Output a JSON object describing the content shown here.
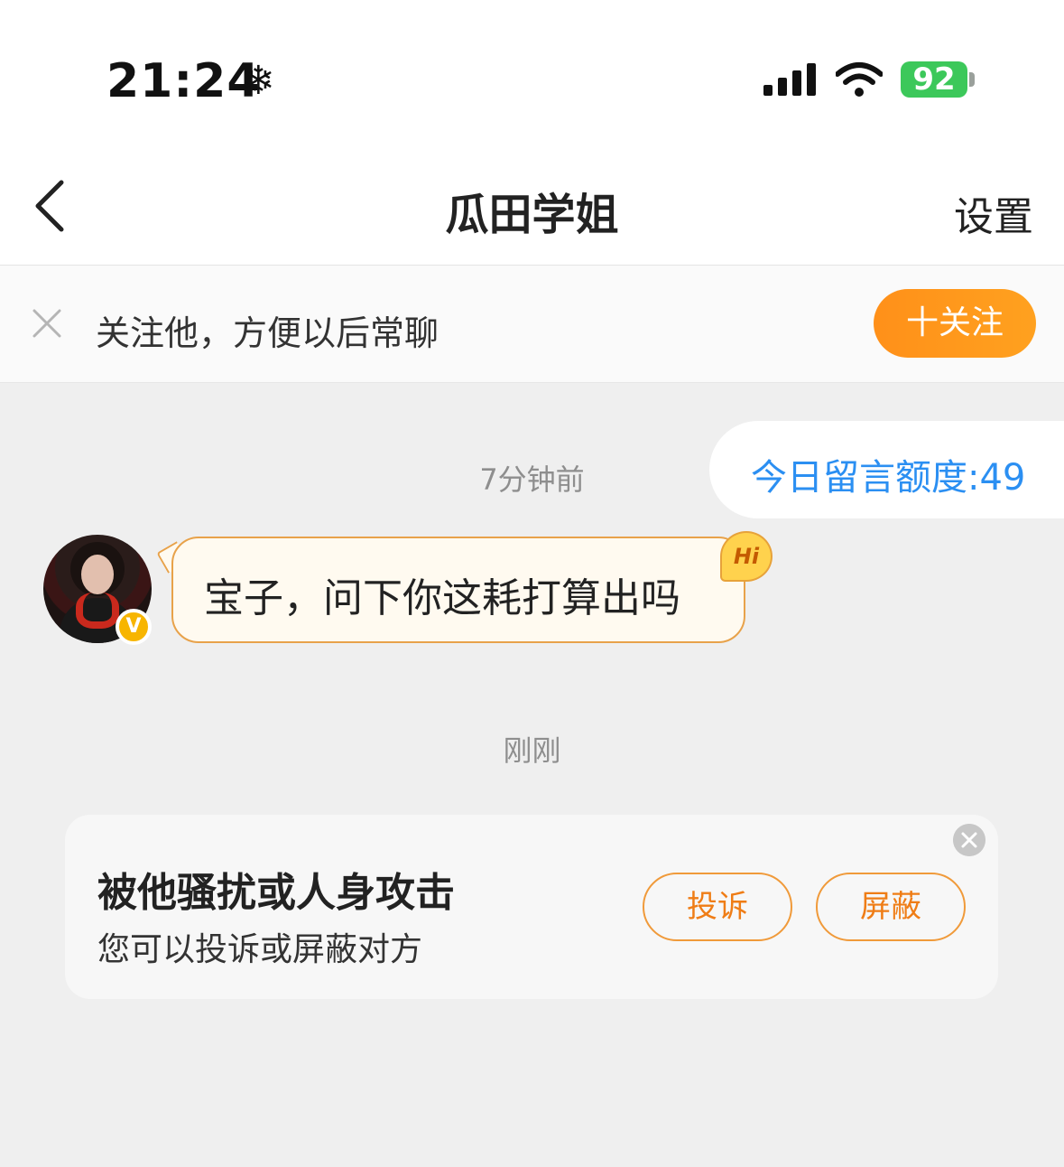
{
  "status_bar": {
    "time": "21:24",
    "battery": "92"
  },
  "header": {
    "title": "瓜田学姐",
    "settings_label": "设置"
  },
  "follow_prompt": {
    "text": "关注他，方便以后常聊",
    "button_label": "十关注"
  },
  "quota": {
    "text": "今日留言额度:49"
  },
  "messages": {
    "timestamp_1": "7分钟前",
    "message_1": "宝子，问下你这耗打算出吗",
    "hi_badge": "Hi",
    "verified_badge": "V",
    "timestamp_2": "刚刚"
  },
  "report_card": {
    "title": "被他骚扰或人身攻击",
    "subtitle": "您可以投诉或屏蔽对方",
    "complain_label": "投诉",
    "block_label": "屏蔽"
  },
  "colors": {
    "accent_orange": "#ff9019",
    "quota_blue": "#2b8ff2",
    "battery_green": "#3cc85a"
  },
  "icons": [
    "snowflake-icon",
    "signal-icon",
    "wifi-icon",
    "battery-icon",
    "back-icon",
    "close-icon",
    "verified-icon",
    "hi-icon"
  ]
}
